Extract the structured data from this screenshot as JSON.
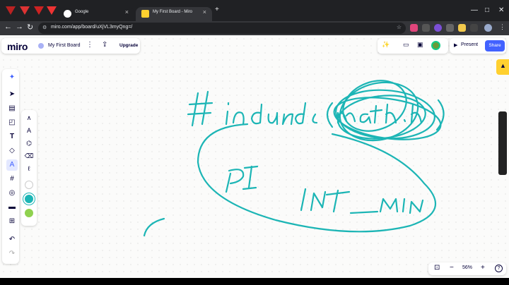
{
  "browser": {
    "tabs": [
      {
        "title": "Google",
        "favicon_color": "#4285f4"
      },
      {
        "title": "My First Board - Miro",
        "favicon_color": "#ffd02f"
      }
    ],
    "new_tab_glyph": "+",
    "address": "miro.com/app/board/uXjVL3myQng=/",
    "window_controls": [
      "—",
      "□",
      "✕"
    ]
  },
  "miro": {
    "logo": "miro",
    "board_title": "My First Board",
    "upgrade_label": "Upgrade",
    "present_label": "Present",
    "share_label": "Share",
    "zoom_label": "56%",
    "help_glyph": "?",
    "accent": "#4262ff",
    "ink_color": "#1cb5b5",
    "left_tools": [
      "ai-sparkle-icon",
      "select-icon",
      "frames-icon",
      "sticky-note-icon",
      "text-icon",
      "shapes-icon",
      "pen-icon",
      "frame-crop-icon",
      "comment-icon",
      "chat-icon",
      "add-icon",
      "undo-icon",
      "redo-icon"
    ],
    "pen_tools": [
      "pen-icon",
      "marker-icon",
      "highlighter-icon",
      "eraser-icon",
      "lasso-icon"
    ],
    "pen_colors": [
      "#ffffff",
      "#1cb5b5",
      "#8fd14f"
    ]
  }
}
